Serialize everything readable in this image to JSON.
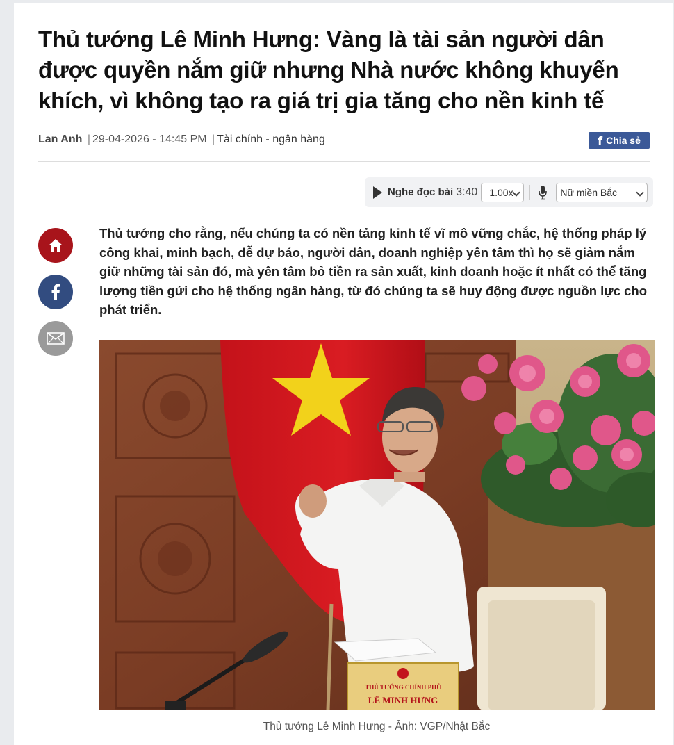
{
  "article": {
    "title": "Thủ tướng Lê Minh Hưng: Vàng là tài sản người dân được quyền nắm giữ nhưng Nhà nước không khuyến khích, vì không tạo ra giá trị gia tăng cho nền kinh tế",
    "author": "Lan Anh",
    "separator": "|",
    "datetime": "29-04-2026 - 14:45 PM",
    "category": "Tài chính - ngân hàng",
    "lead": "Thủ tướng cho rằng, nếu chúng ta có nền tảng kinh tế vĩ mô vững chắc, hệ thống pháp lý công khai, minh bạch, dễ dự báo, người dân, doanh nghiệp yên tâm thì họ sẽ giảm nắm giữ những tài sản đó, mà yên tâm bỏ tiền ra sản xuất, kinh doanh hoặc ít nhất có thể tăng lượng tiền gửi cho hệ thống ngân hàng, từ đó chúng ta sẽ huy động được nguồn lực cho phát triển.",
    "image_caption": "Thủ tướng Lê Minh Hưng - Ảnh: VGP/Nhật Bắc",
    "nameplate": {
      "line1": "THỦ TƯỚNG CHÍNH PHỦ",
      "line2": "LÊ MINH HƯNG"
    }
  },
  "share": {
    "facebook_icon": "f",
    "label": "Chia sẻ"
  },
  "audio_player": {
    "play_icon": "play-icon",
    "label": "Nghe đọc bài",
    "duration": "3:40",
    "speed": "1.00x",
    "mic_icon": "microphone-icon",
    "voice": "Nữ miền Bắc"
  },
  "social_sidebar": {
    "icons": [
      "home-icon",
      "facebook-icon",
      "mail-icon"
    ],
    "colors": {
      "home": "#a8141b",
      "facebook": "#324c80",
      "mail": "#9a9a9a"
    }
  }
}
